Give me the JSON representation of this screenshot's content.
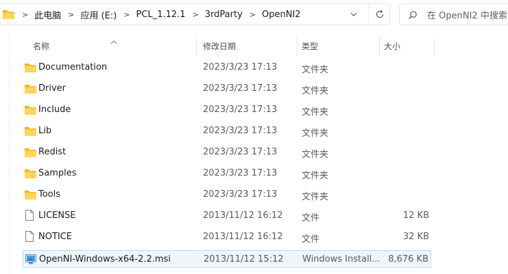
{
  "address": {
    "breadcrumb": [
      "此电脑",
      "应用 (E:)",
      "PCL_1.12.1",
      "3rdParty",
      "OpenNI2"
    ],
    "separator": ">"
  },
  "search": {
    "placeholder": "在 OpenNI2 中搜索"
  },
  "columns": {
    "name": "名称",
    "date": "修改日期",
    "type": "类型",
    "size": "大小",
    "sorted_by": "name"
  },
  "files": [
    {
      "name": "Documentation",
      "date": "2023/3/23 17:13",
      "type": "文件夹",
      "size": "",
      "icon": "folder-icon"
    },
    {
      "name": "Driver",
      "date": "2023/3/23 17:13",
      "type": "文件夹",
      "size": "",
      "icon": "folder-icon"
    },
    {
      "name": "Include",
      "date": "2023/3/23 17:13",
      "type": "文件夹",
      "size": "",
      "icon": "folder-icon"
    },
    {
      "name": "Lib",
      "date": "2023/3/23 17:13",
      "type": "文件夹",
      "size": "",
      "icon": "folder-icon"
    },
    {
      "name": "Redist",
      "date": "2023/3/23 17:13",
      "type": "文件夹",
      "size": "",
      "icon": "folder-icon"
    },
    {
      "name": "Samples",
      "date": "2023/3/23 17:13",
      "type": "文件夹",
      "size": "",
      "icon": "folder-icon"
    },
    {
      "name": "Tools",
      "date": "2023/3/23 17:13",
      "type": "文件夹",
      "size": "",
      "icon": "folder-icon"
    },
    {
      "name": "LICENSE",
      "date": "2013/11/12 16:12",
      "type": "文件",
      "size": "12 KB",
      "icon": "document-icon"
    },
    {
      "name": "NOTICE",
      "date": "2013/11/12 16:12",
      "type": "文件",
      "size": "32 KB",
      "icon": "document-icon"
    },
    {
      "name": "OpenNI-Windows-x64-2.2.msi",
      "date": "2013/11/12 15:12",
      "type": "Windows Install...",
      "size": "8,676 KB",
      "icon": "msi-installer-icon",
      "selected": true
    }
  ],
  "colors": {
    "folder": "#f5c233",
    "selection_bg": "#eef5fb",
    "selection_border": "#bcdcf4"
  }
}
